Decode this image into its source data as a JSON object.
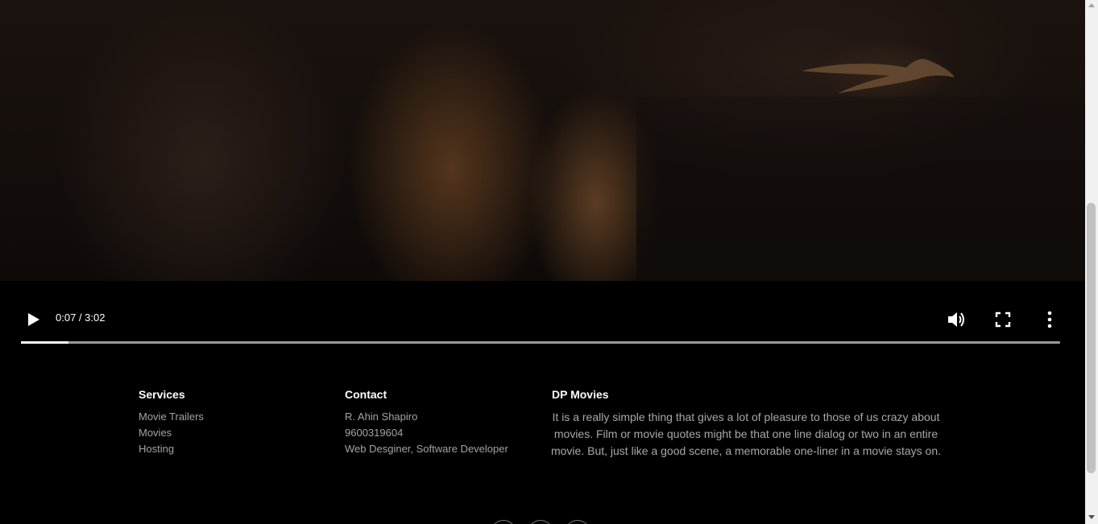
{
  "video": {
    "current_time": "0:07",
    "separator": " / ",
    "duration": "3:02",
    "progress_fraction": 0.046,
    "play_icon": "play-icon",
    "volume_icon": "volume-icon",
    "fullscreen_icon": "fullscreen-icon",
    "menu_icon": "more-options-icon"
  },
  "footer": {
    "services": {
      "heading": "Services",
      "items": [
        "Movie Trailers",
        "Movies",
        "Hosting"
      ]
    },
    "contact": {
      "heading": "Contact",
      "items": [
        "R. Ahin Shapiro",
        "9600319604",
        "Web Desginer, Software Developer"
      ]
    },
    "about": {
      "heading": "DP Movies",
      "text": "It is a really simple thing that gives a lot of pleasure to those of us crazy about movies. Film or movie quotes might be that one line dialog or two in an entire movie.  But, just like a good scene, a memorable one-liner in a movie stays on."
    },
    "social_icons": [
      "facebook-icon",
      "twitter-icon",
      "instagram-icon"
    ]
  },
  "colors": {
    "background": "#000000",
    "footer_text": "#a3a3a3",
    "heading": "#ffffff",
    "progress": "#ffffff",
    "track": "#9a9a9a"
  }
}
